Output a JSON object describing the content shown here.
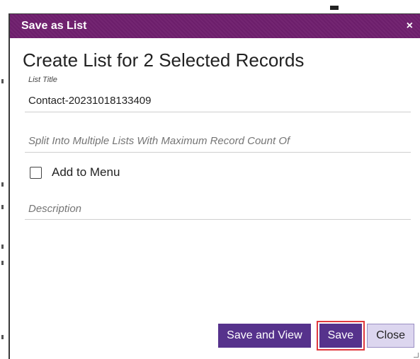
{
  "dialog": {
    "title": "Save as List",
    "close_glyph": "×"
  },
  "form": {
    "heading": "Create List for 2 Selected Records",
    "list_title_label": "List Title",
    "list_title_value": "Contact-20231018133409",
    "split_placeholder": "Split Into Multiple Lists With Maximum Record Count Of",
    "add_to_menu_label": "Add to Menu",
    "add_to_menu_checked": false,
    "description_placeholder": "Description"
  },
  "buttons": {
    "save_and_view": "Save and View",
    "save": "Save",
    "close": "Close"
  },
  "colors": {
    "titlebar": "#6f1f6e",
    "primary_button": "#56328c",
    "secondary_button": "#dcd6ef",
    "highlight": "#e0393e"
  }
}
